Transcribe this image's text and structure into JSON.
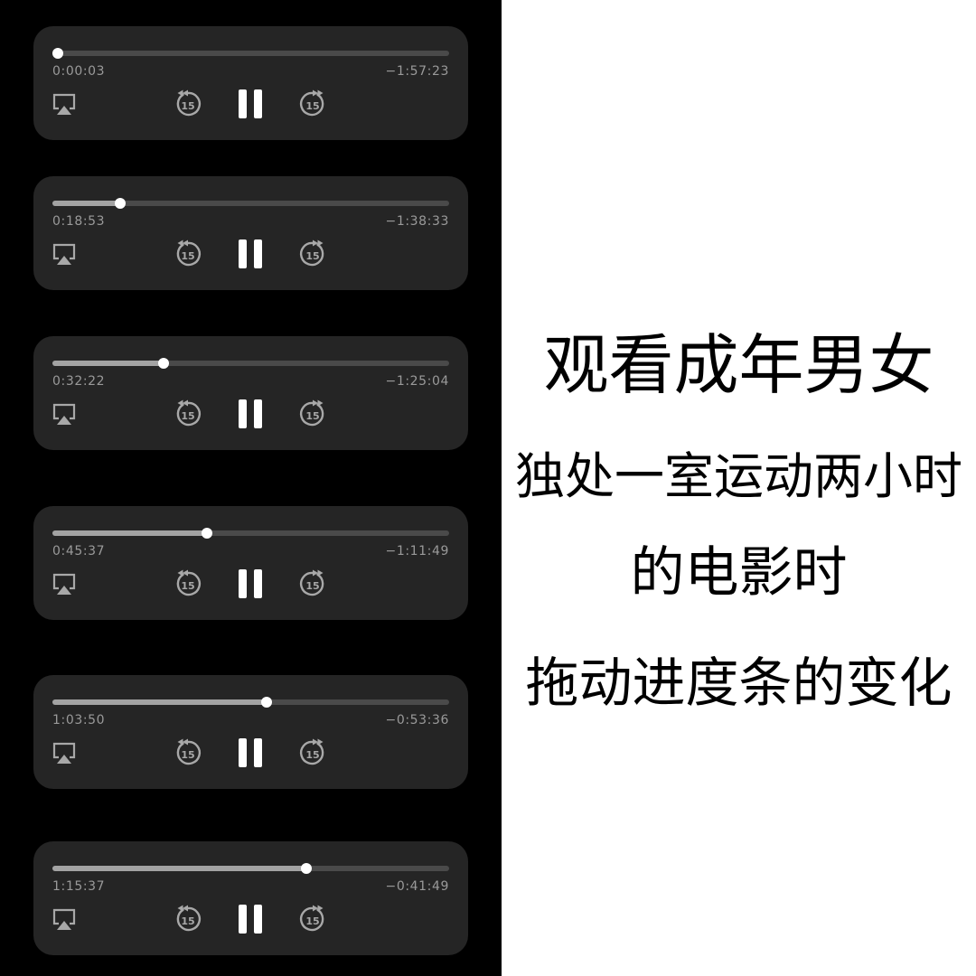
{
  "players": [
    {
      "elapsed": "0:00:03",
      "remaining": "−1:57:23",
      "progress": 0.013
    },
    {
      "elapsed": "0:18:53",
      "remaining": "−1:38:33",
      "progress": 0.17
    },
    {
      "elapsed": "0:32:22",
      "remaining": "−1:25:04",
      "progress": 0.28
    },
    {
      "elapsed": "0:45:37",
      "remaining": "−1:11:49",
      "progress": 0.39
    },
    {
      "elapsed": "1:03:50",
      "remaining": "−0:53:36",
      "progress": 0.54
    },
    {
      "elapsed": "1:15:37",
      "remaining": "−0:41:49",
      "progress": 0.64
    }
  ],
  "controls": {
    "airplay_icon": "airplay-icon",
    "skip_back_icon": "skip-back-15-icon",
    "pause_icon": "pause-icon",
    "skip_forward_icon": "skip-forward-15-icon",
    "skip_seconds": "15"
  },
  "caption": {
    "line1": "观看成年男女",
    "line2": "独处一室运动两小时",
    "line3": "的电影时",
    "line4": "拖动进度条的变化"
  },
  "colors": {
    "left_background": "#000000",
    "player_background": "#252525",
    "track": "#4a4a4a",
    "track_fill": "#a3a3a3",
    "knob": "#ffffff",
    "time_text": "#9a9a9a",
    "caption_text": "#000000"
  }
}
